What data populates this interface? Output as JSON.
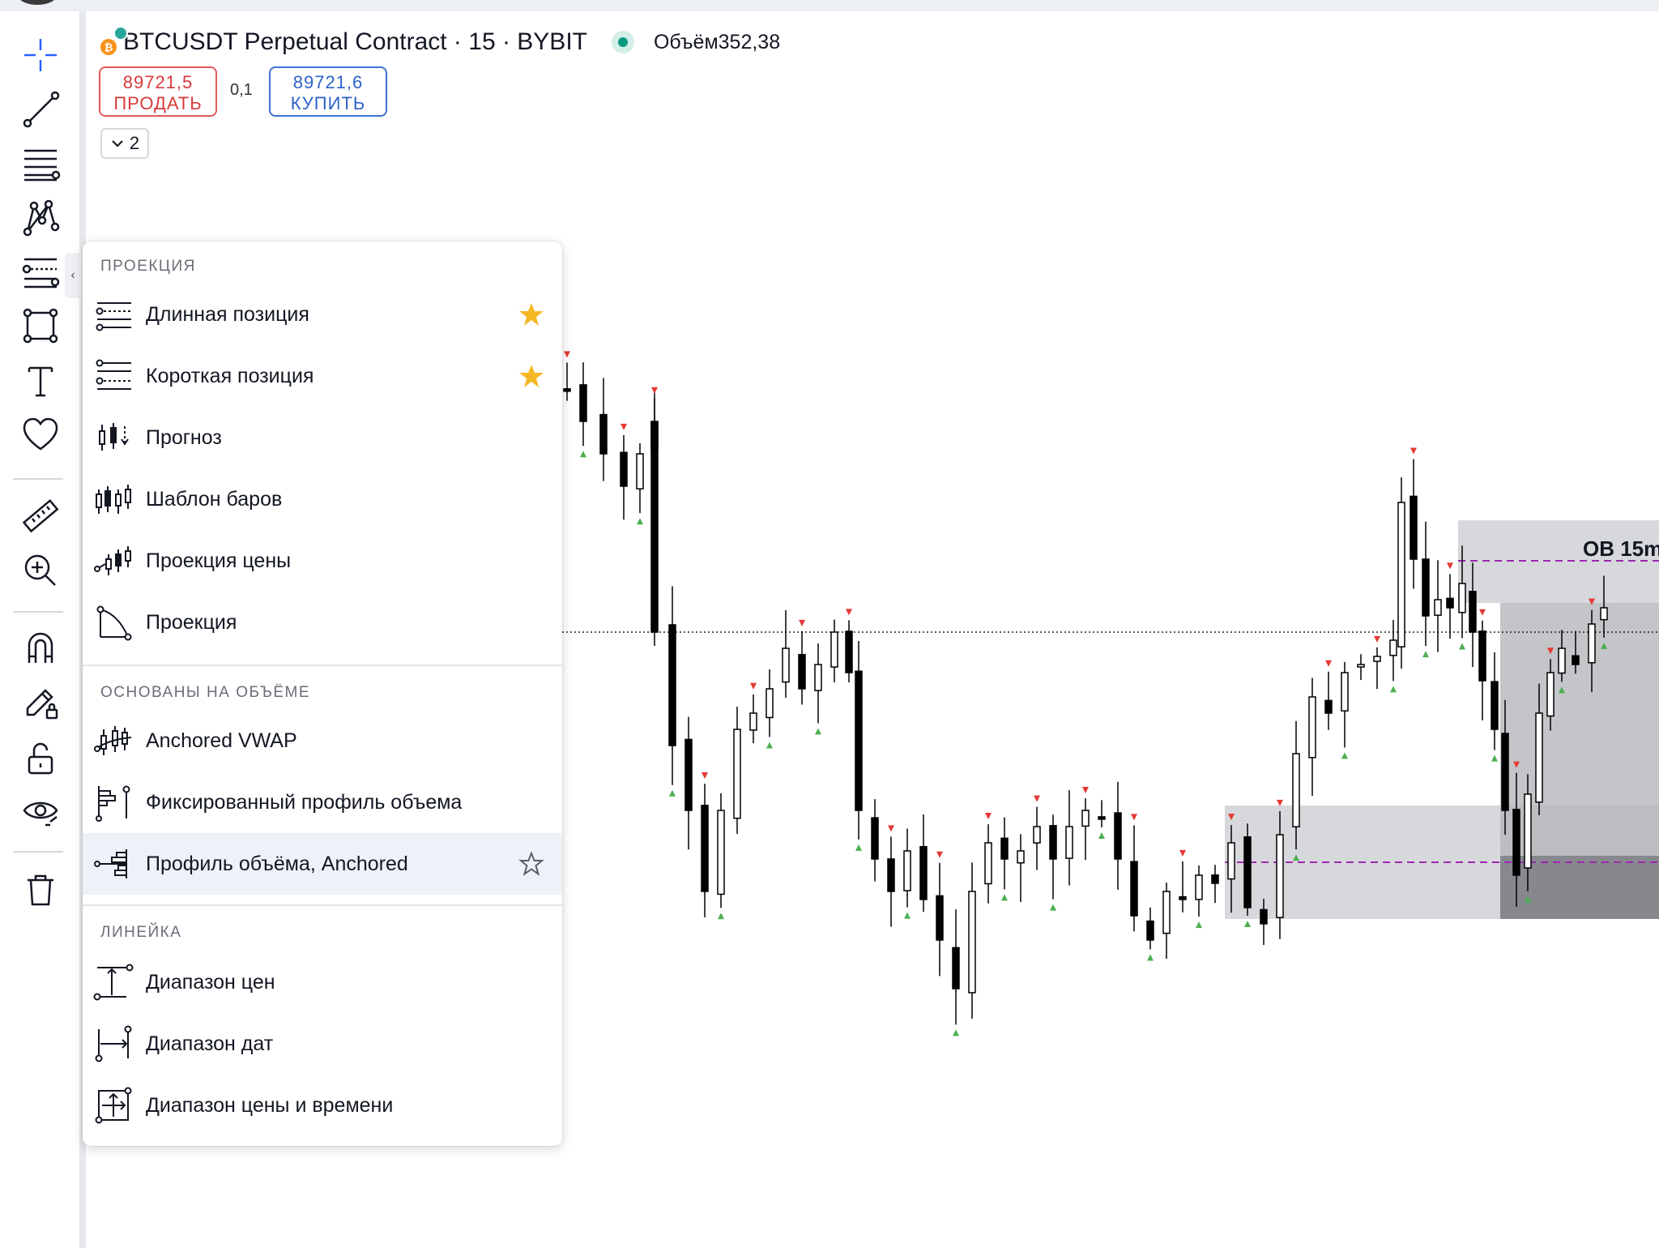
{
  "header": {
    "symbol": "BTCUSDT Perpetual Contract · 15 · BYBIT",
    "volume": "Объём352,38",
    "coin_glyph": "₿"
  },
  "trade": {
    "sell_price": "89721,5",
    "sell_label": "ПРОДАТЬ",
    "spread": "0,1",
    "buy_price": "89721,6",
    "buy_label": "КУПИТЬ",
    "collapsed_count": "2"
  },
  "toolbar": {
    "icons": [
      "crosshair-icon",
      "trend-line-icon",
      "fib-retracement-icon",
      "pattern-icon",
      "projection-icon",
      "rectangle-icon",
      "text-icon",
      "favorites-heart-icon",
      "ruler-icon",
      "zoom-in-icon",
      "magnet-icon",
      "pencil-lock-icon",
      "lock-icon",
      "eye-icon",
      "trash-icon"
    ],
    "collapse_glyph": "‹"
  },
  "menu": {
    "sections": [
      {
        "title": "ПРОЕКЦИЯ",
        "items": [
          {
            "label": "Длинная позиция",
            "icon": "long-position-icon",
            "favorite": true
          },
          {
            "label": "Короткая позиция",
            "icon": "short-position-icon",
            "favorite": true
          },
          {
            "label": "Прогноз",
            "icon": "forecast-icon",
            "favorite": false
          },
          {
            "label": "Шаблон баров",
            "icon": "bars-pattern-icon",
            "favorite": false
          },
          {
            "label": "Проекция цены",
            "icon": "price-projection-icon",
            "favorite": false
          },
          {
            "label": "Проекция",
            "icon": "projection-arc-icon",
            "favorite": false
          }
        ]
      },
      {
        "title": "ОСНОВАНЫ НА ОБЪЁМЕ",
        "items": [
          {
            "label": "Anchored VWAP",
            "icon": "anchored-vwap-icon",
            "favorite": false
          },
          {
            "label": "Фиксированный профиль объема",
            "icon": "fixed-volume-profile-icon",
            "favorite": false
          },
          {
            "label": "Профиль объёма, Anchored",
            "icon": "anchored-volume-profile-icon",
            "favorite": false,
            "hovered": true
          }
        ]
      },
      {
        "title": "ЛИНЕЙКА",
        "items": [
          {
            "label": "Диапазон цен",
            "icon": "price-range-icon",
            "favorite": false
          },
          {
            "label": "Диапазон дат",
            "icon": "date-range-icon",
            "favorite": false
          },
          {
            "label": "Диапазон цены и времени",
            "icon": "date-price-range-icon",
            "favorite": false
          }
        ]
      }
    ]
  },
  "chart": {
    "annotation": "OB 15m",
    "colors": {
      "up_marker": "#4caf50",
      "down_marker": "#e53935",
      "zone": "#c9cbcf",
      "dashed_level": "#9c27b0",
      "candle": "#000000"
    }
  }
}
